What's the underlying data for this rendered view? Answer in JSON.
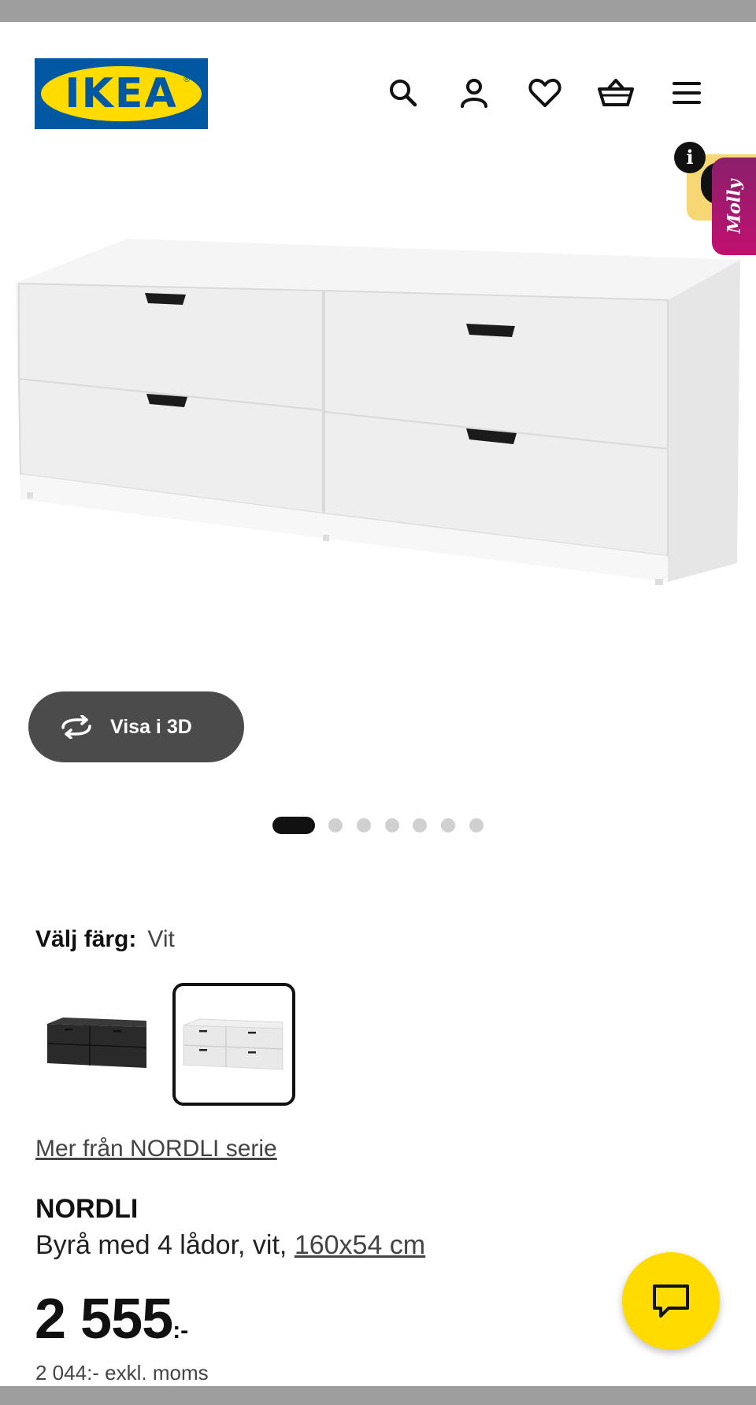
{
  "brand": {
    "logo_text": "IKEA",
    "logo_registered": "®",
    "logo_blue": "#0058a3",
    "logo_yellow": "#ffdb00"
  },
  "header": {
    "icons": [
      "search-icon",
      "account-icon",
      "heart-icon",
      "basket-icon",
      "menu-icon"
    ]
  },
  "promo": {
    "info_glyph": "i",
    "tab_label": "Molly"
  },
  "gallery": {
    "view3d_label": "Visa i 3D",
    "view3d_icon": "rotate-arrows-icon",
    "total_images": 7,
    "active_index": 0
  },
  "product": {
    "color_label": "Välj färg:",
    "color_value": "Vit",
    "swatches": [
      {
        "name": "black",
        "selected": false
      },
      {
        "name": "white",
        "selected": true
      }
    ],
    "series_link": "Mer från NORDLI serie",
    "name": "NORDLI",
    "description": "Byrå med 4 lådor, vit, ",
    "size_link": "160x54 cm",
    "price_main": "2 555",
    "price_suffix": ":-",
    "price_exkl": "2 044:- exkl. moms"
  },
  "chat": {
    "icon": "chat-bubble-icon",
    "color": "#ffdb00"
  },
  "colors": {
    "status_bar": "#9e9e9e",
    "button_dark": "#4b4b4b",
    "promo_pink": "#c0106f",
    "promo_yellow": "#f7d774"
  }
}
